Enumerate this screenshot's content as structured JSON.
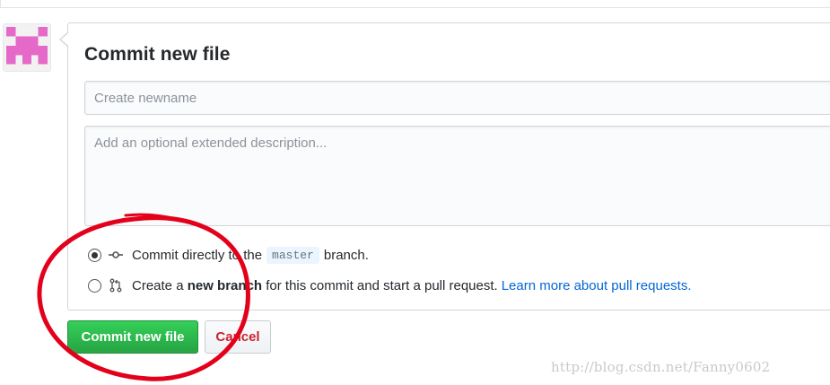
{
  "form": {
    "title": "Commit new file",
    "summary_placeholder": "Create newname",
    "summary_value": "",
    "description_placeholder": "Add an optional extended description...",
    "description_value": ""
  },
  "options": {
    "direct": {
      "selected": true,
      "text_before": "Commit directly to the",
      "branch": "master",
      "text_after": "branch."
    },
    "new_branch": {
      "selected": false,
      "text_before": "Create a",
      "bold_text": "new branch",
      "text_after": "for this commit and start a pull request.",
      "link_text": "Learn more about pull requests."
    }
  },
  "buttons": {
    "commit_label": "Commit new file",
    "cancel_label": "Cancel"
  },
  "watermark": "http://blog.csdn.net/Fanny0602",
  "colors": {
    "primary_button": "#28a745",
    "cancel_text": "#cb2431",
    "link": "#0366d6",
    "annotation_circle": "#e3001b",
    "avatar_identicon": "#e469c9"
  },
  "icons": {
    "direct_commit": "git-commit-icon",
    "new_branch": "git-pull-request-icon"
  }
}
